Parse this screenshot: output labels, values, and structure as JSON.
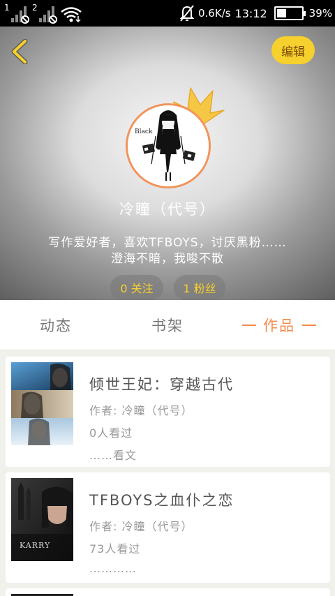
{
  "status_bar": {
    "sim1": "1",
    "sim2": "2",
    "network_speed": "0.6K/s",
    "time": "13:12",
    "battery_percent": "39%",
    "battery_level": 0.39,
    "icons": [
      "signal-icon",
      "no-signal-icon",
      "wifi-icon",
      "mute-icon",
      "battery-icon"
    ]
  },
  "header": {
    "back_icon": "back-arrow-icon",
    "edit_label": "编辑",
    "avatar_caption": "Black",
    "nickname": "冷瞳（代号）",
    "bio_line1": "写作爱好者，喜欢TFBOYS，讨厌黑粉……",
    "bio_line2": "澄海不暗，我唆不散",
    "following": "0 关注",
    "followers": "1 粉丝",
    "colors": {
      "accent": "#f6d02c",
      "avatar_border": "#f2935a",
      "crown": "#f6c744"
    }
  },
  "tabs": [
    {
      "label": "动态",
      "active": false
    },
    {
      "label": "书架",
      "active": false
    },
    {
      "label": "作品",
      "active": true
    }
  ],
  "active_tab_color": "#f58a4b",
  "works": [
    {
      "title": "倾世王妃：穿越古代",
      "author": "作者: 冷瞳（代号）",
      "views": "0人看过",
      "excerpt": "……看文"
    },
    {
      "title": "TFBOYS之血仆之恋",
      "author": "作者: 冷瞳（代号）",
      "views": "73人看过",
      "excerpt": "…………",
      "cover_text": "KARRY"
    }
  ]
}
